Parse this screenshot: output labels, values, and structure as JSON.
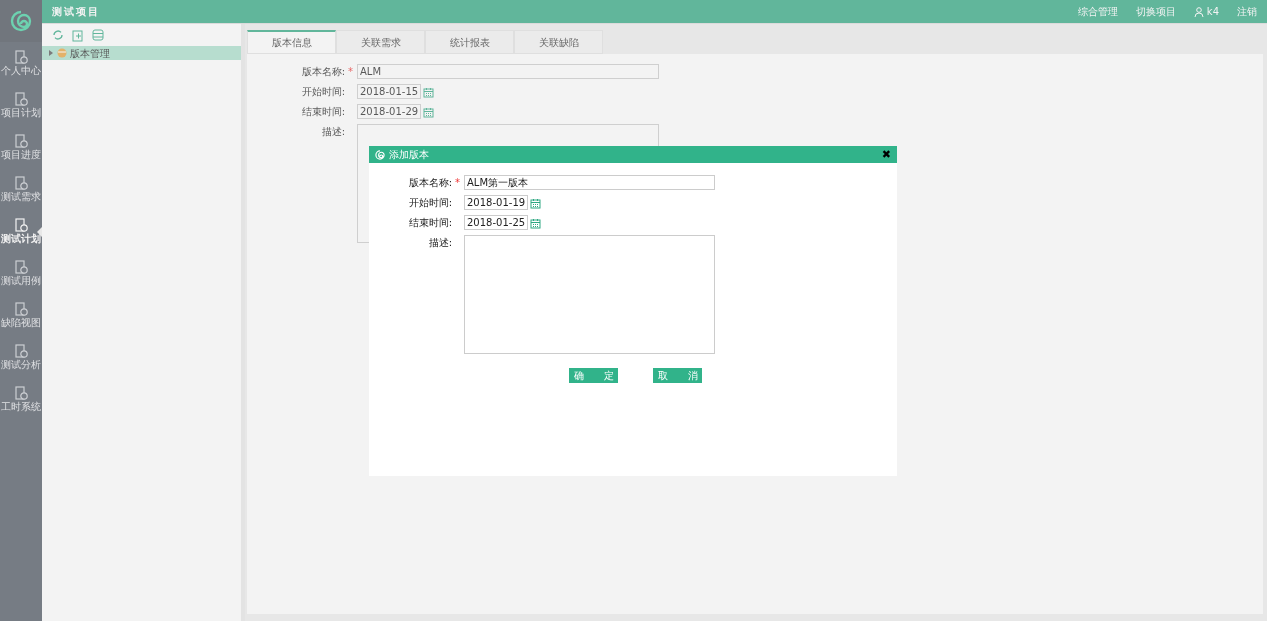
{
  "header": {
    "title": "测试项目",
    "links": [
      {
        "kind": "text",
        "label": "综合管理"
      },
      {
        "kind": "text",
        "label": "切换项目"
      },
      {
        "kind": "user",
        "label": "k4"
      },
      {
        "kind": "text",
        "label": "注销"
      }
    ]
  },
  "sidebar": {
    "items": [
      {
        "label": "个人中心",
        "selected": false
      },
      {
        "label": "项目计划",
        "selected": false
      },
      {
        "label": "项目进度",
        "selected": false
      },
      {
        "label": "测试需求",
        "selected": false
      },
      {
        "label": "测试计划",
        "selected": true
      },
      {
        "label": "测试用例",
        "selected": false
      },
      {
        "label": "缺陷视图",
        "selected": false
      },
      {
        "label": "测试分析",
        "selected": false
      },
      {
        "label": "工时系统",
        "selected": false
      }
    ]
  },
  "tree": {
    "items": [
      {
        "label": "版本管理",
        "selected": true,
        "expanded": false
      }
    ]
  },
  "tabs": [
    {
      "label": "版本信息",
      "selected": true
    },
    {
      "label": "关联需求",
      "selected": false
    },
    {
      "label": "统计报表",
      "selected": false
    },
    {
      "label": "关联缺陷",
      "selected": false
    }
  ],
  "form": {
    "fields": [
      {
        "label": "版本名称:",
        "kind": "text",
        "required_mark": "*",
        "value": "ALM"
      },
      {
        "label": "开始时间:",
        "kind": "date",
        "value": "2018-01-15"
      },
      {
        "label": "结束时间:",
        "kind": "date",
        "value": "2018-01-29"
      },
      {
        "label": "描述:",
        "kind": "textarea"
      }
    ]
  },
  "dialog": {
    "title": "添加版本",
    "close": "✖",
    "fields": [
      {
        "label": "版本名称:",
        "kind": "text",
        "required_mark": "*",
        "value": "ALM第一版本"
      },
      {
        "label": "开始时间:",
        "kind": "date",
        "value": "2018-01-19"
      },
      {
        "label": "结束时间:",
        "kind": "date",
        "value": "2018-01-25"
      },
      {
        "label": "描述:",
        "kind": "textarea"
      }
    ],
    "buttons": [
      "确　　定",
      "取　　消"
    ]
  }
}
